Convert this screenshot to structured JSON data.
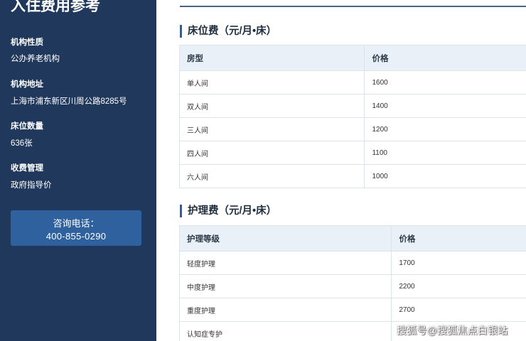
{
  "sidebar": {
    "title": "入住费用参考",
    "items": [
      {
        "label": "机构性质",
        "value": "公办养老机构"
      },
      {
        "label": "机构地址",
        "value": "上海市浦东新区川周公路8285号"
      },
      {
        "label": "床位数量",
        "value": "636张"
      },
      {
        "label": "收费管理",
        "value": "政府指导价"
      }
    ],
    "consult": {
      "label": "咨询电话：",
      "phone": "400-855-0290"
    }
  },
  "bed_fee": {
    "title": "床位费（元/月•床）",
    "headers": [
      "房型",
      "价格"
    ],
    "rows": [
      [
        "单人间",
        "1600"
      ],
      [
        "双人间",
        "1400"
      ],
      [
        "三人间",
        "1200"
      ],
      [
        "四人间",
        "1100"
      ],
      [
        "六人间",
        "1000"
      ]
    ]
  },
  "care_fee": {
    "title": "护理费（元/月•床）",
    "headers": [
      "护理等级",
      "价格"
    ],
    "rows": [
      [
        "轻度护理",
        "1700"
      ],
      [
        "中度护理",
        "2200"
      ],
      [
        "重度护理",
        "2700"
      ],
      [
        "认知症专护",
        ""
      ]
    ]
  },
  "watermark": "搜狐号@搜狐焦点白银站",
  "colors": {
    "sidebar_bg": "#20385c",
    "consult_bg": "#2f619e",
    "accent": "#2f5fa0",
    "table_header_bg": "#eaf0f8"
  }
}
